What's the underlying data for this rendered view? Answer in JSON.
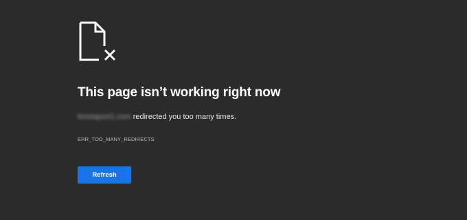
{
  "page": {
    "title": "This page isn’t working right now",
    "message_domain": "kinstaport1.com",
    "message_suffix": " redirected you too many times.",
    "error_code": "ERR_TOO_MANY_REDIRECTS",
    "refresh_label": "Refresh",
    "icon": "broken-document-icon"
  },
  "colors": {
    "background": "#2b2b2b",
    "title": "#ffffff",
    "button": "#1a73e8"
  }
}
